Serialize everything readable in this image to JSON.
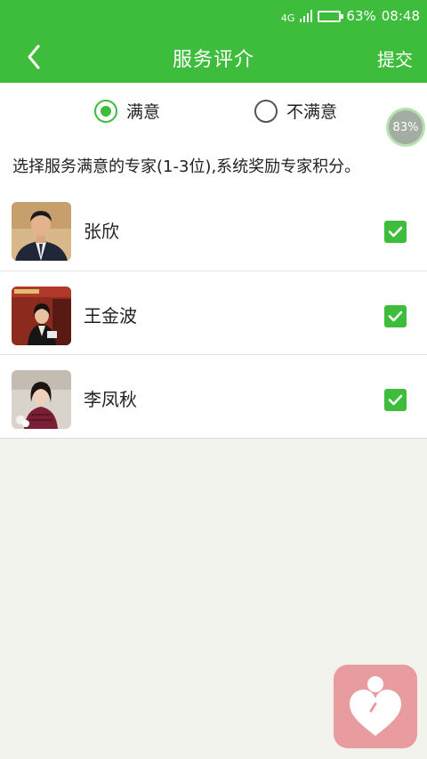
{
  "status_bar": {
    "network": "4G",
    "battery_level": 0.63,
    "battery": "63%",
    "time": "08:48"
  },
  "header": {
    "title": "服务评介",
    "submit_label": "提交",
    "back_icon": "chevron-left-icon"
  },
  "rating": {
    "options": [
      {
        "label": "满意",
        "selected": true
      },
      {
        "label": "不满意",
        "selected": false
      }
    ]
  },
  "progress_badge": "83%",
  "instruction": "选择服务满意的专家(1-3位),系统奖励专家积分。",
  "experts": [
    {
      "name": "张欣",
      "checked": true
    },
    {
      "name": "王金波",
      "checked": true
    },
    {
      "name": "李凤秋",
      "checked": true
    }
  ],
  "colors": {
    "accent": "#3ebc3b",
    "floater": "#e89ca0"
  }
}
